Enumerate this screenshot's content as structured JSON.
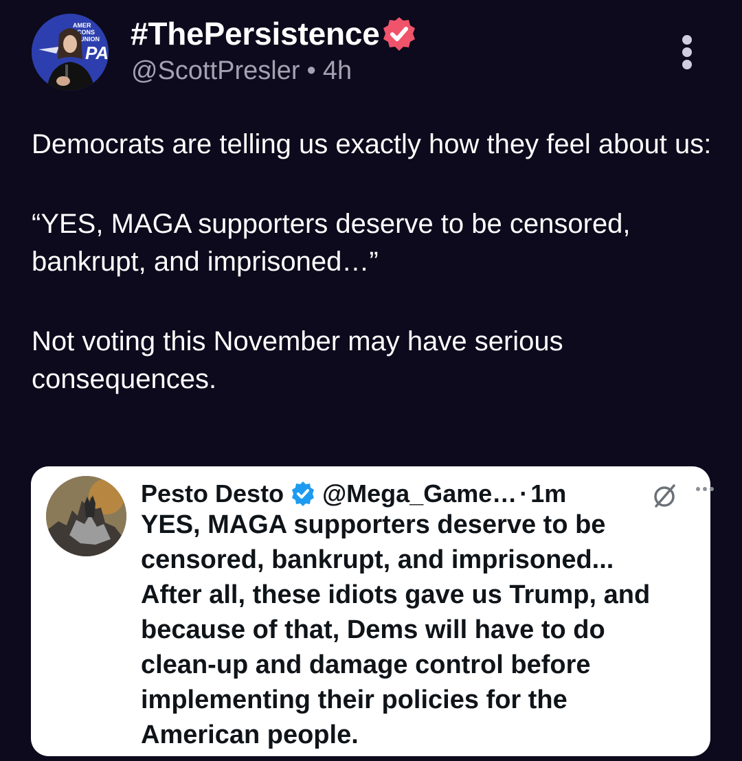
{
  "post": {
    "author": {
      "display_name": "#ThePersistence",
      "handle": "@ScottPresler",
      "timestamp": "4h",
      "separator": "•",
      "avatar_icon": "profile-photo-avatar",
      "verified_icon": "verified-badge-icon",
      "verified_color": "#f0546a"
    },
    "more_icon": "more-vertical-icon",
    "body": {
      "paragraph_1": "Democrats are telling us exactly how they feel about us:",
      "paragraph_2": "“YES, MAGA supporters deserve to be censored, bankrupt, and imprisoned…”",
      "paragraph_3": "Not voting this November may have serious consequences."
    }
  },
  "quoted_post": {
    "display_name": "Pesto Desto",
    "handle": "@Mega_Game…",
    "separator": "·",
    "timestamp": "1m",
    "verified_icon": "verified-badge-icon",
    "verified_color": "#1d9bf0",
    "grok_icon": "grok-icon",
    "more_icon": "more-horizontal-icon",
    "text": "YES, MAGA supporters deserve to be\ncensored, bankrupt, and imprisoned...\nAfter all,  these idiots gave us Trump, and\nbecause of that, Dems will have to do\nclean-up and damage control before\nimplementing their policies for the\nAmerican people."
  },
  "colors": {
    "background": "#0c0a1c",
    "text_primary": "#ffffff",
    "text_secondary": "#a3a1b2",
    "card_background": "#ffffff",
    "card_text": "#0f1419"
  }
}
